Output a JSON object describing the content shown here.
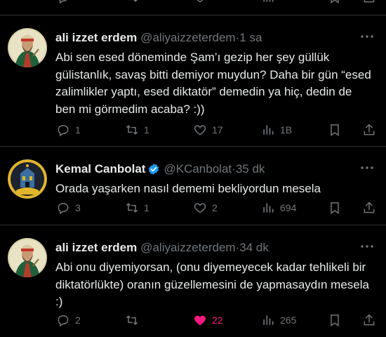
{
  "tweets": [
    {
      "name": "ali izzet erdem",
      "handle": "@aliyaizzeterdem",
      "dot": "·",
      "time": "1 sa",
      "text": "Abi sen esed döneminde Şam’ı gezip her şey güllük gülistanlık, savaş bitti demiyor muydun? Daha bir gün “esed zalimlikler yaptı, esed diktatör” demedin ya hiç, dedin de ben mi görmedim acaba? :))",
      "replies": "1",
      "retweets": "1",
      "likes": "17",
      "views": "1B",
      "liked": false
    },
    {
      "name": "Kemal Canbolat",
      "handle": "@KCanbolat",
      "dot": "·",
      "time": "35 dk",
      "text": "Orada yaşarken nasıl dememi bekliyordun mesela",
      "replies": "3",
      "retweets": "1",
      "likes": "2",
      "views": "694",
      "liked": false,
      "verified": true
    },
    {
      "name": "ali izzet erdem",
      "handle": "@aliyaizzeterdem",
      "dot": "·",
      "time": "34 dk",
      "text": "Abi onu diyemiyorsan, (onu diyemeyecek kadar tehlikeli bir diktatörlükte) oranın güzellemesini de yapmasaydın mesela :)",
      "replies": "2",
      "retweets": "",
      "likes": "22",
      "views": "265",
      "liked": true
    }
  ],
  "colors": {
    "background": "#000000",
    "text": "#e7e9ea",
    "muted": "#71767b",
    "like": "#f91880",
    "verified": "#1d9bf0",
    "divider": "#2f3336"
  }
}
